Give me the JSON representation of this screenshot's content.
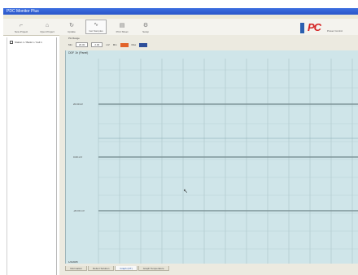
{
  "window": {
    "title": "PDC Monitor Plus"
  },
  "toolbar": {
    "buttons": [
      {
        "label": "New Project"
      },
      {
        "label": "Open Project"
      },
      {
        "label": "Update"
      },
      {
        "label": "Get Samples"
      },
      {
        "label": "Print Sheet"
      },
      {
        "label": "Setup"
      }
    ]
  },
  "brand": {
    "logo": "PC",
    "sub": "Power Control"
  },
  "tree": {
    "items": [
      {
        "label": "Station 1 / Bank 1 / Cell 1"
      }
    ]
  },
  "options": {
    "header": "PH Range",
    "range_label": "Min",
    "range_value": "20.00",
    "step_value": "2.00",
    "step_unit": "mV",
    "color_a_label": "Min",
    "color_b_label": "Max"
  },
  "plot": {
    "title": "DDF 1h (Panel)",
    "y_labels": [
      "20.00 kV",
      "0.00 mV",
      "-20.00 mV"
    ],
    "x_label": "1/2/2005"
  },
  "tabs": [
    {
      "label": "Information"
    },
    {
      "label": "Defect Solution"
    },
    {
      "label": "Graph (OT)"
    },
    {
      "label": "Graph Temperature"
    }
  ],
  "colors": {
    "plot_bg": "#cfe5e9",
    "accent_red": "#e2632a",
    "accent_blue": "#2e4f9a"
  }
}
